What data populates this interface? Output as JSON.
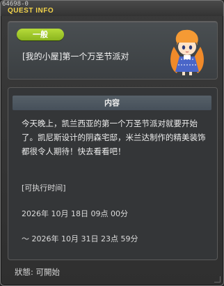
{
  "window": {
    "quest_id": "64698-0",
    "title": "QUEST INFO"
  },
  "header": {
    "category": "一般",
    "quest_name": "[我的小屋]第一个万圣节派对",
    "npc_icon": "npc-portrait-icon"
  },
  "content": {
    "section_title": "内容",
    "description": "今天晚上，凯兰西亚的第一个万圣节派对就要开始了。凯尼斯设计的阴森宅邸，米兰达制作的精美装饰都很令人期待！快去看看吧！",
    "time_label": "[可执行时间]",
    "time_start": "2026年 10月 18日 09点 00分",
    "time_end": "～ 2026年 10月 31日 23点 59分"
  },
  "footer": {
    "status": "狀態: 可開始"
  },
  "colors": {
    "title": "#f2d34a",
    "badge": "#9cc62a",
    "section_header": "#4f5962"
  }
}
